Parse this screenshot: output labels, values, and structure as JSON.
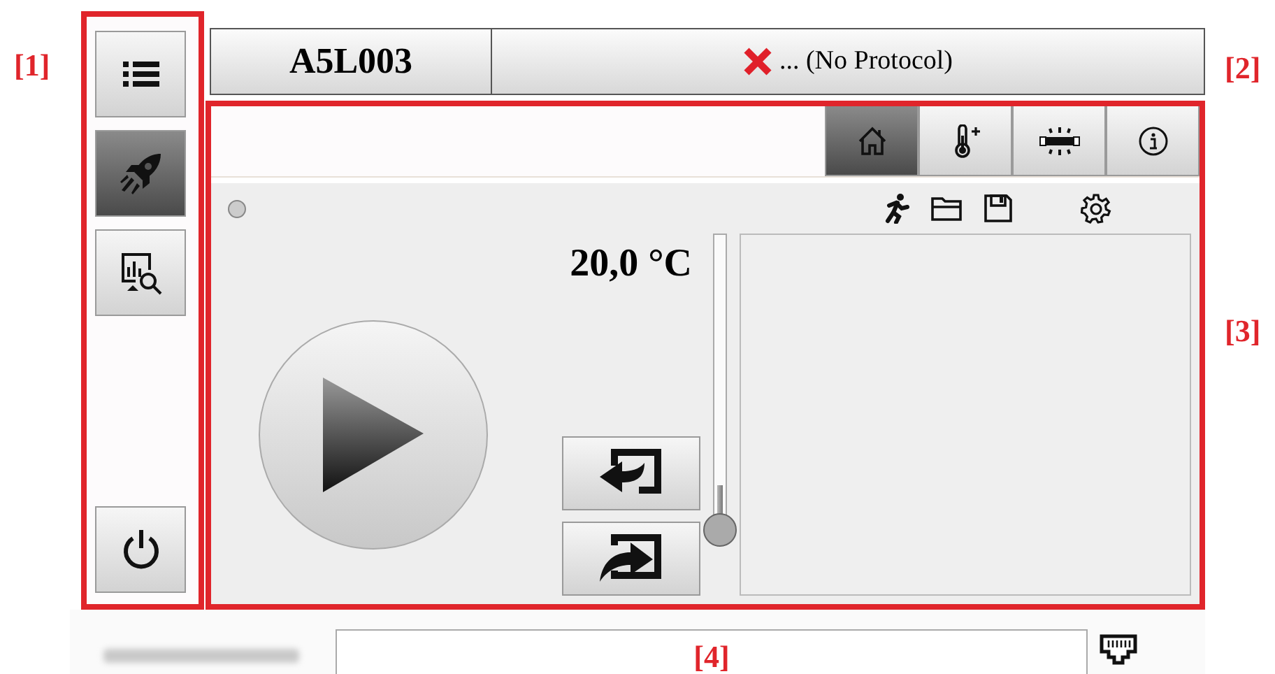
{
  "callouts": [
    {
      "label": "[1]"
    },
    {
      "label": "[2]"
    },
    {
      "label": "[3]"
    },
    {
      "label": "[4]"
    }
  ],
  "sidebar": {
    "items": [
      {
        "kind": "list",
        "selected": false
      },
      {
        "kind": "rocket",
        "selected": true
      },
      {
        "kind": "chart-search",
        "selected": false
      },
      {
        "kind": "power",
        "selected": false
      }
    ]
  },
  "header": {
    "device": "A5L003",
    "protocol": "... (No Protocol)"
  },
  "tabs": [
    {
      "kind": "home",
      "selected": true
    },
    {
      "kind": "thermometer",
      "selected": false
    },
    {
      "kind": "lightbar",
      "selected": false
    },
    {
      "kind": "info",
      "selected": false
    }
  ],
  "toolbar": [
    {
      "kind": "runner"
    },
    {
      "kind": "folder"
    },
    {
      "kind": "save"
    },
    {
      "kind": "settings"
    }
  ],
  "temperature": {
    "reading": "20,0 °C"
  },
  "slider": {
    "level": 0.15
  }
}
